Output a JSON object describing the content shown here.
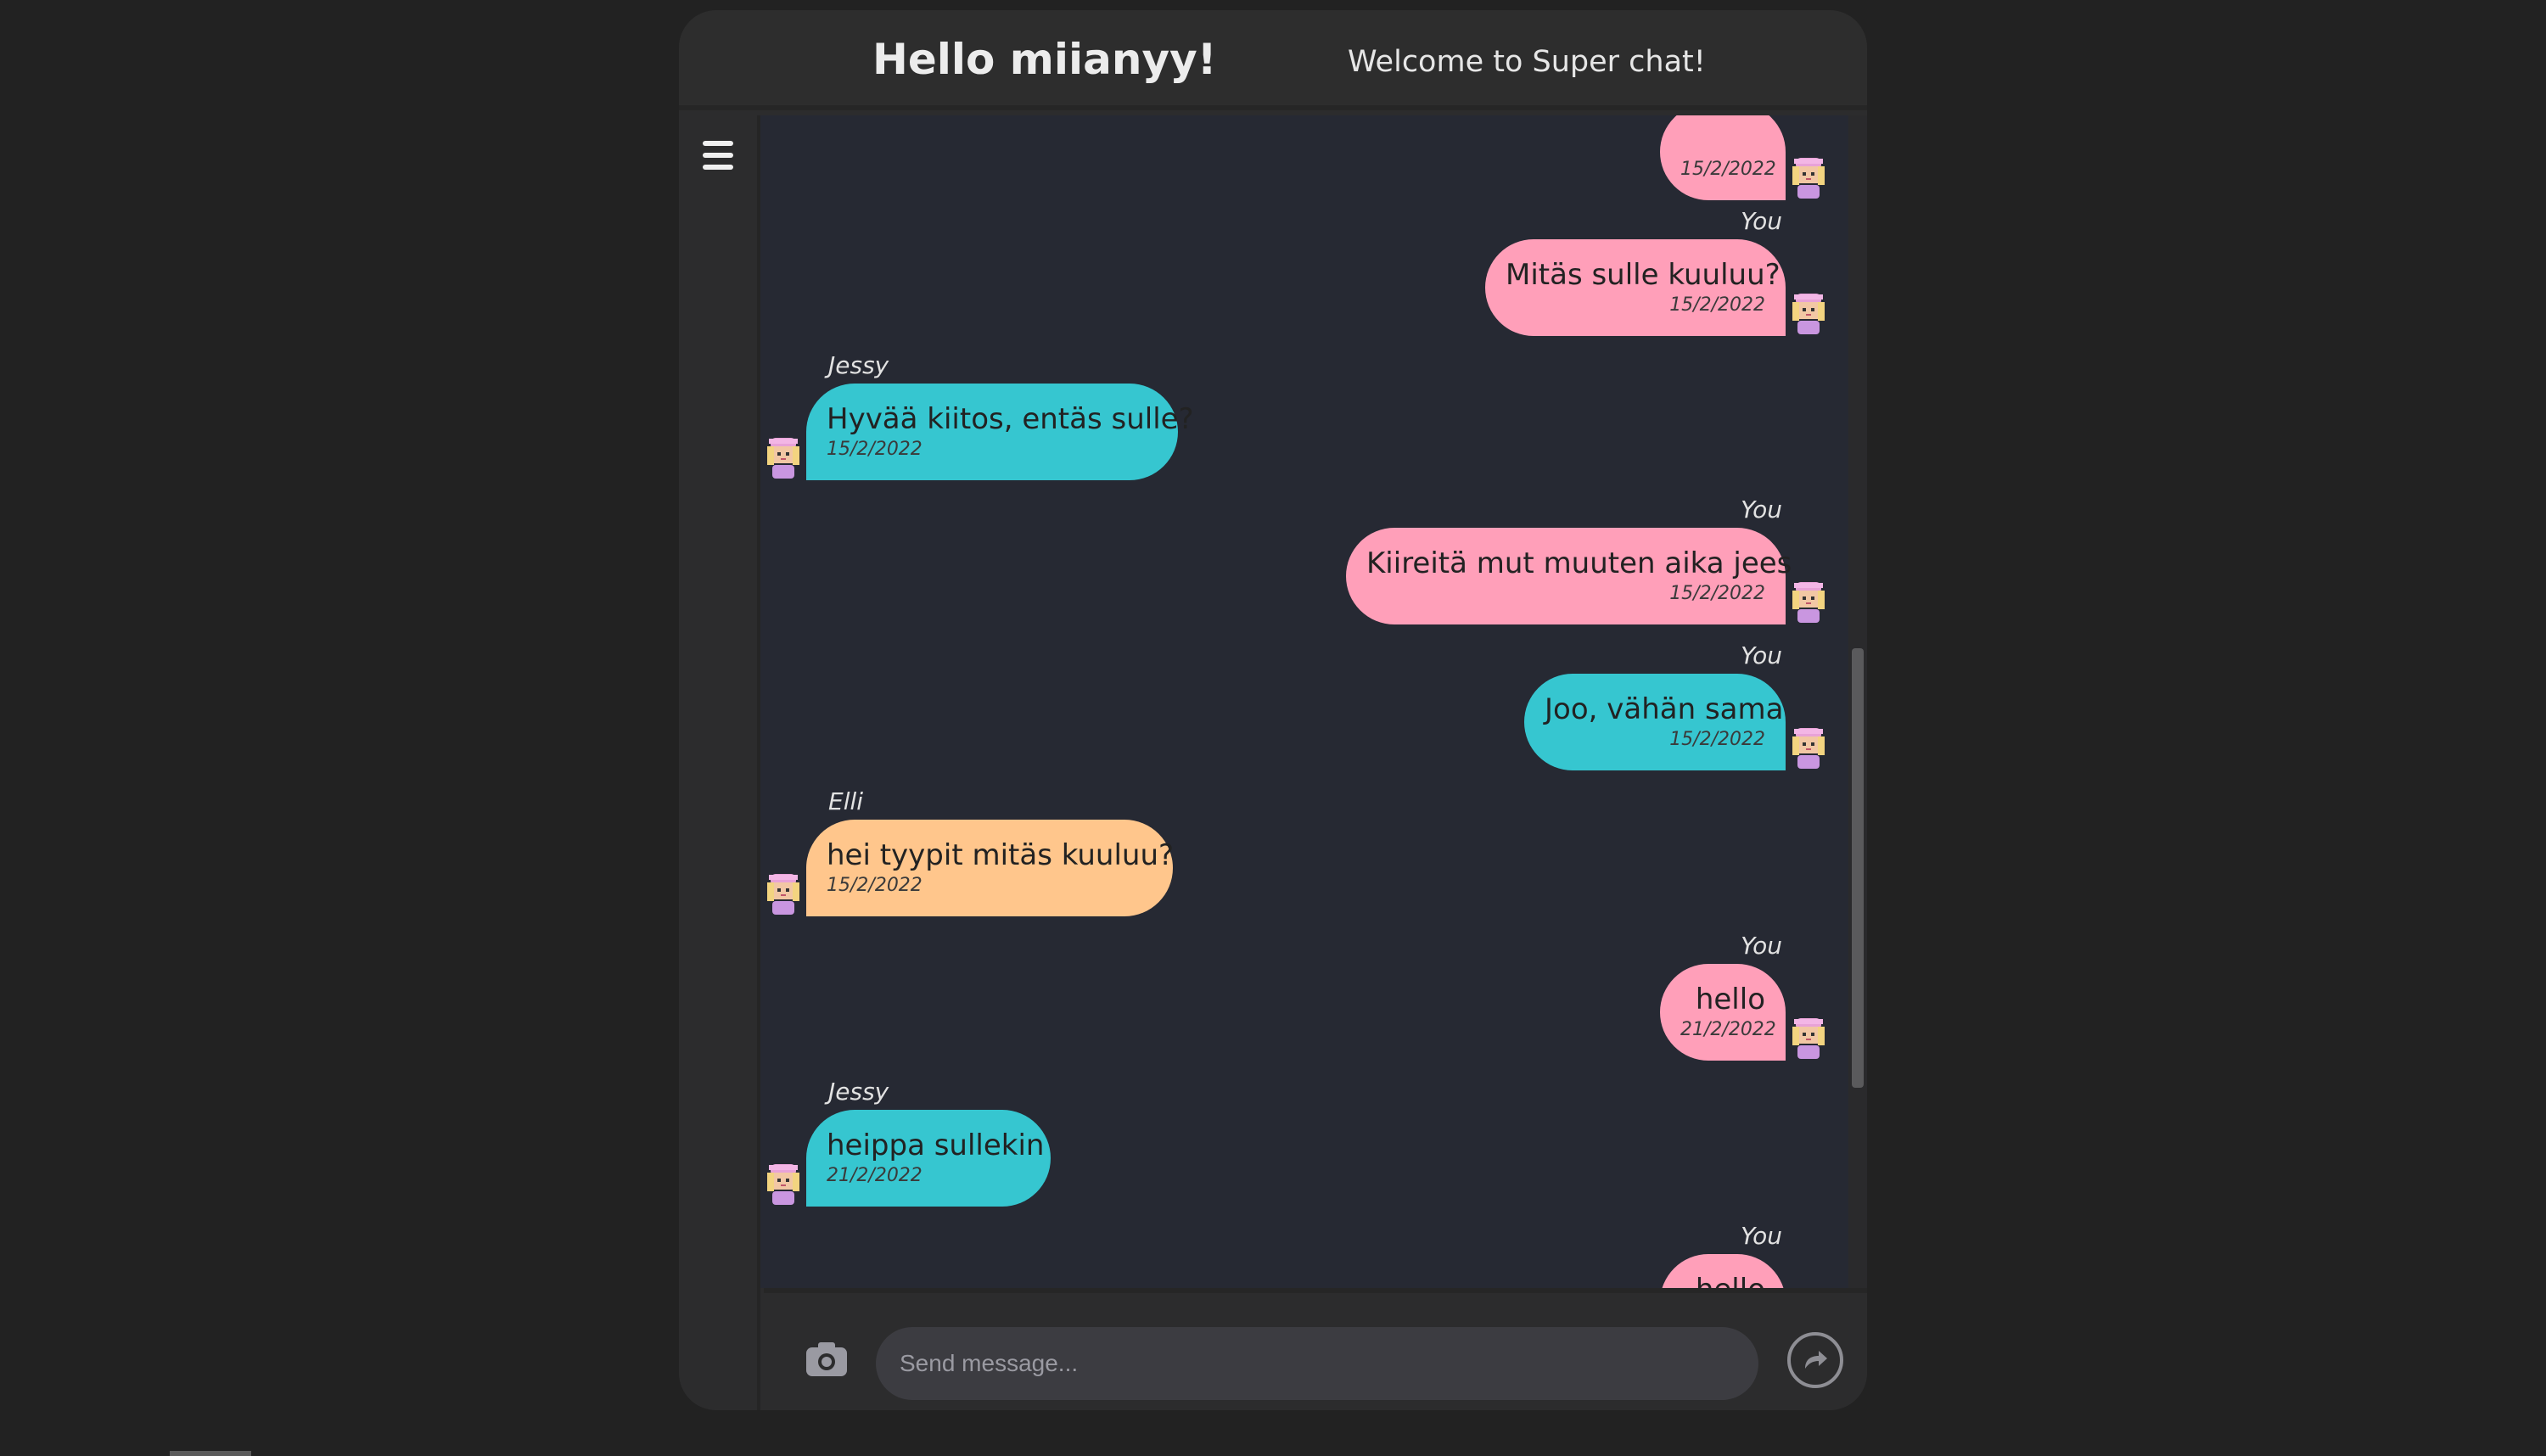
{
  "header": {
    "greeting": "Hello miianyy!",
    "welcome": "Welcome to Super chat!"
  },
  "colors": {
    "own": "#ff9fb9",
    "teal": "#36c6d0",
    "orange": "#ffc68c",
    "bg": "#262933"
  },
  "messages": [
    {
      "side": "right",
      "sender": "",
      "text": "",
      "date": "15/2/2022",
      "color": "#ff9fb9",
      "partial": "top"
    },
    {
      "side": "right",
      "sender": "You",
      "text": "Mitäs sulle kuuluu?",
      "date": "15/2/2022",
      "color": "#ff9fb9"
    },
    {
      "side": "left",
      "sender": "Jessy",
      "text": "Hyvää kiitos, entäs sulle?",
      "date": "15/2/2022",
      "color": "#36c6d0"
    },
    {
      "side": "right",
      "sender": "You",
      "text": "Kiireitä mut muuten aika jees",
      "date": "15/2/2022",
      "color": "#ff9fb9"
    },
    {
      "side": "right",
      "sender": "You",
      "text": "Joo, vähän sama",
      "date": "15/2/2022",
      "color": "#36c6d0"
    },
    {
      "side": "left",
      "sender": "Elli",
      "text": "hei tyypit mitäs kuuluu?",
      "date": "15/2/2022",
      "color": "#ffc68c"
    },
    {
      "side": "right",
      "sender": "You",
      "text": "hello",
      "date": "21/2/2022",
      "color": "#ff9fb9"
    },
    {
      "side": "left",
      "sender": "Jessy",
      "text": "heippa sullekin",
      "date": "21/2/2022",
      "color": "#36c6d0"
    },
    {
      "side": "right",
      "sender": "You",
      "text": "hello",
      "date": "",
      "color": "#ff9fb9",
      "partial": "bottom"
    }
  ],
  "composer": {
    "placeholder": "Send message..."
  },
  "icons": {
    "menu": "hamburger-menu-icon",
    "camera": "camera-icon",
    "send": "share-arrow-icon",
    "avatar": "pixel-girl-avatar-icon"
  }
}
